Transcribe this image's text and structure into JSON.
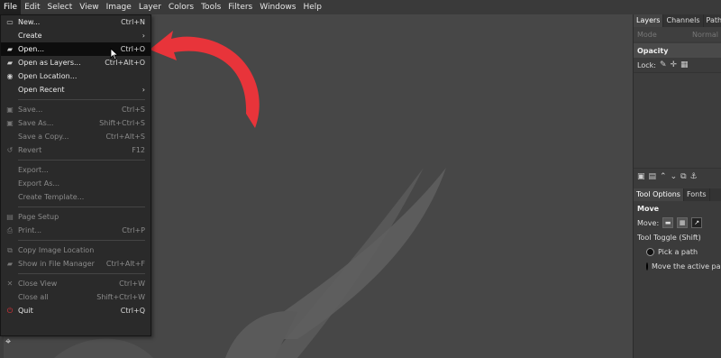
{
  "menubar": {
    "items": [
      "File",
      "Edit",
      "Select",
      "View",
      "Image",
      "Layer",
      "Colors",
      "Tools",
      "Filters",
      "Windows",
      "Help"
    ],
    "active": "File"
  },
  "file_menu": {
    "new": {
      "label": "New...",
      "shortcut": "Ctrl+N"
    },
    "create": {
      "label": "Create",
      "arrow": "›"
    },
    "open": {
      "label": "Open...",
      "shortcut": "Ctrl+O"
    },
    "open_as_layers": {
      "label": "Open as Layers...",
      "shortcut": "Ctrl+Alt+O"
    },
    "open_location": {
      "label": "Open Location..."
    },
    "open_recent": {
      "label": "Open Recent",
      "arrow": "›"
    },
    "save": {
      "label": "Save...",
      "shortcut": "Ctrl+S"
    },
    "save_as": {
      "label": "Save As...",
      "shortcut": "Shift+Ctrl+S"
    },
    "save_copy": {
      "label": "Save a Copy...",
      "shortcut": "Ctrl+Alt+S"
    },
    "revert": {
      "label": "Revert",
      "shortcut": "F12"
    },
    "export": {
      "label": "Export..."
    },
    "export_as": {
      "label": "Export As..."
    },
    "create_template": {
      "label": "Create Template..."
    },
    "page_setup": {
      "label": "Page Setup"
    },
    "print": {
      "label": "Print...",
      "shortcut": "Ctrl+P"
    },
    "copy_image_location": {
      "label": "Copy Image Location"
    },
    "show_in_file_manager": {
      "label": "Show in File Manager",
      "shortcut": "Ctrl+Alt+F"
    },
    "close_view": {
      "label": "Close View",
      "shortcut": "Ctrl+W"
    },
    "close_all": {
      "label": "Close all",
      "shortcut": "Shift+Ctrl+W"
    },
    "quit": {
      "label": "Quit",
      "shortcut": "Ctrl+Q"
    }
  },
  "dock": {
    "tabs": [
      "Layers",
      "Channels",
      "Paths"
    ],
    "mode_label": "Mode",
    "mode_value": "Normal",
    "opacity_label": "Opacity",
    "lock_label": "Lock:",
    "tool_tabs": [
      "Tool Options",
      "Fonts"
    ],
    "tool_title": "Move",
    "move_label": "Move:",
    "tool_toggle": "Tool Toggle  (Shift)",
    "option_pick": "Pick a path",
    "option_move": "Move the active pa"
  },
  "colors": {
    "annotation_arrow": "#e8343a",
    "menu_bg": "#2a2a2a",
    "canvas_bg": "#474747"
  }
}
